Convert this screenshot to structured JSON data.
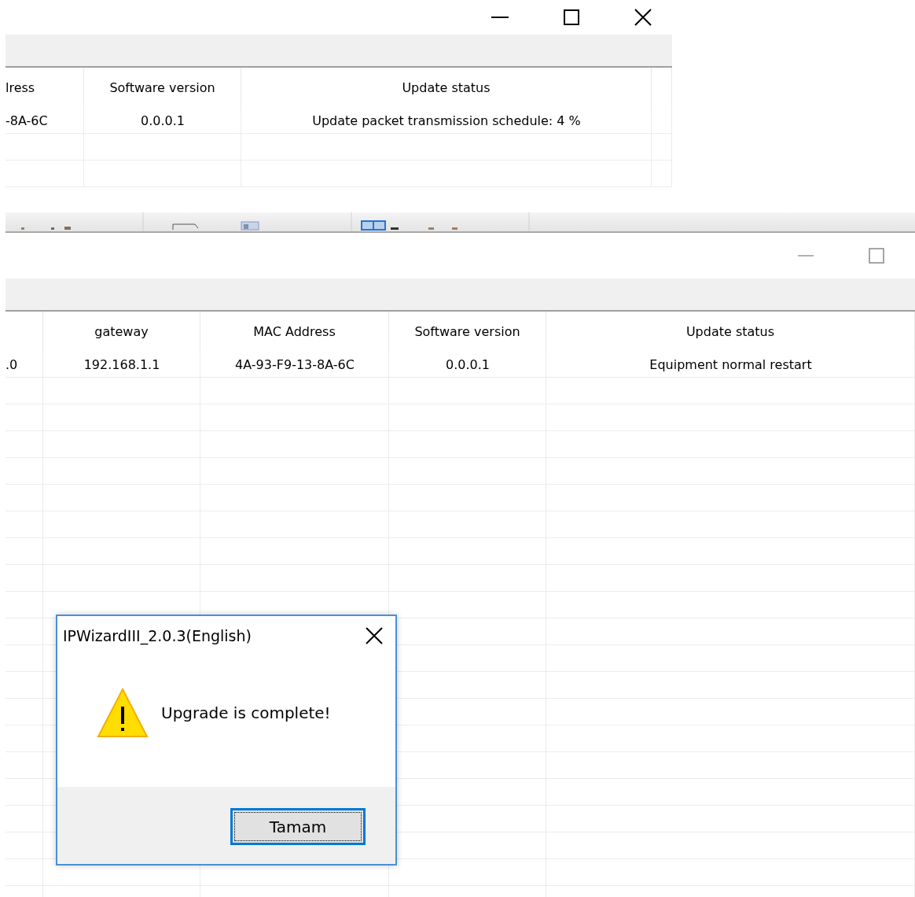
{
  "back_window": {
    "title_buttons": [
      {
        "kind": "minimize"
      },
      {
        "kind": "maximize"
      },
      {
        "kind": "close"
      }
    ],
    "table": {
      "columns": [
        "lress",
        "Software version",
        "Update status"
      ],
      "rows": [
        [
          "-8A-6C",
          "0.0.0.1",
          "Update packet transmission schedule: 4 %"
        ]
      ]
    }
  },
  "front_window": {
    "title_buttons": [
      {
        "kind": "minimize"
      },
      {
        "kind": "maximize"
      }
    ],
    "table": {
      "columns": [
        "",
        "gateway",
        "MAC Address",
        "Software version",
        "Update status"
      ],
      "rows": [
        [
          ".0",
          "192.168.1.1",
          "4A-93-F9-13-8A-6C",
          "0.0.0.1",
          "Equipment normal restart"
        ]
      ]
    }
  },
  "dialog": {
    "title": "IPWizardIII_2.0.3(English)",
    "message": "Upgrade is complete!",
    "button": "Tamam"
  }
}
